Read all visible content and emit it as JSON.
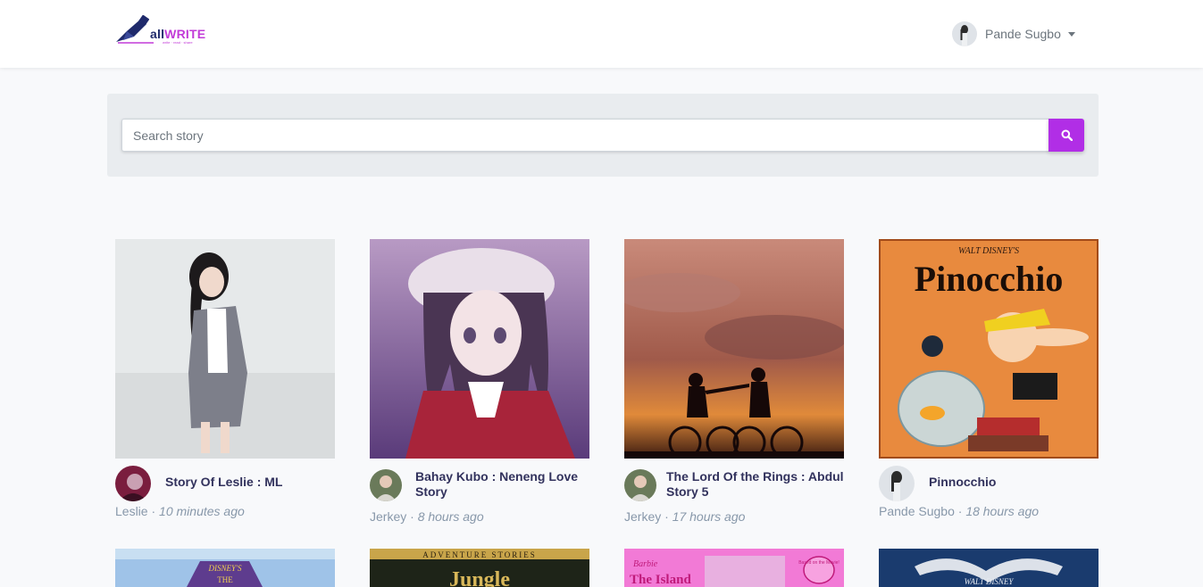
{
  "brand": {
    "name_prefix": "all",
    "name_suffix": "WRITE",
    "tagline": "write · read · share"
  },
  "user": {
    "name": "Pande Sugbo"
  },
  "search": {
    "placeholder": "Search story"
  },
  "stories": [
    {
      "title": "Story Of Leslie : ML",
      "author": "Leslie",
      "time": "10 minutes ago"
    },
    {
      "title": "Bahay Kubo : Neneng Love Story",
      "author": "Jerkey",
      "time": "8 hours ago"
    },
    {
      "title": "The Lord Of the Rings : Abdul Story 5",
      "author": "Jerkey",
      "time": "17 hours ago"
    },
    {
      "title": "Pinnocchio",
      "author": "Pande Sugbo",
      "time": "18 hours ago",
      "cover_title": "Pinocchio",
      "cover_brand": "WALT DISNEY'S"
    }
  ],
  "row2_covers": [
    {
      "brand": "DISNEY'S",
      "text": "THE"
    },
    {
      "brand": "ADVENTURE STORIES",
      "text": "Jungle"
    },
    {
      "brand": "Barbie",
      "text": "The Island",
      "badge": "Based on the Movie!"
    },
    {
      "brand": "WALT DISNEY",
      "text": ""
    }
  ],
  "colors": {
    "accent": "#b12ee6",
    "title": "#32325d",
    "muted": "#8898aa"
  }
}
